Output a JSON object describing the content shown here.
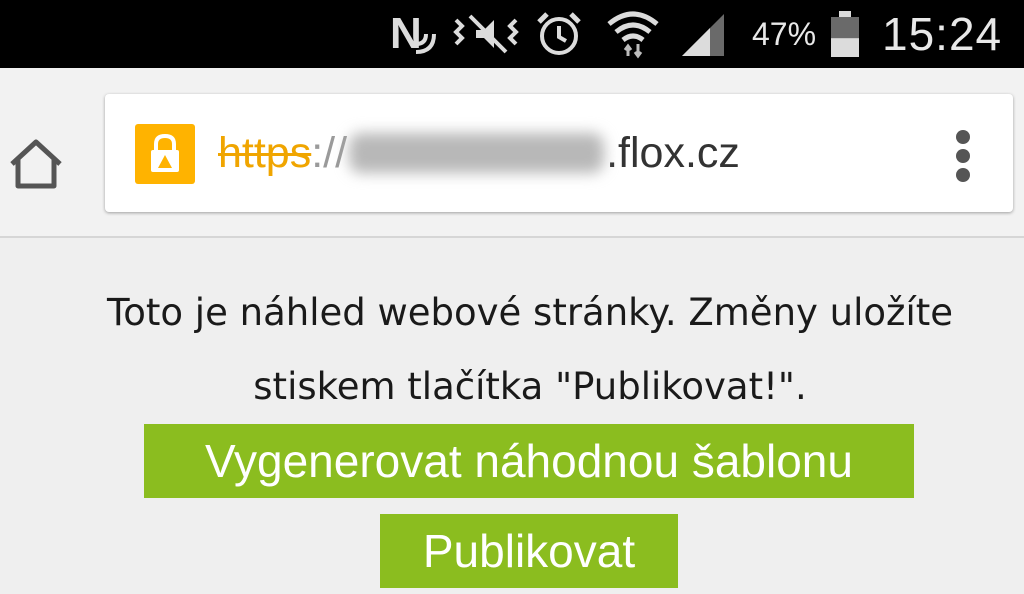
{
  "status_bar": {
    "nfc_label": "N",
    "icons": [
      "nfc-icon",
      "vibrate-icon",
      "alarm-icon",
      "wifi-icon",
      "signal-icon",
      "battery-icon"
    ],
    "battery_percent": "47%",
    "battery_level": 0.47,
    "time": "15:24"
  },
  "toolbar": {
    "url_scheme": "https",
    "url_separator": "://",
    "url_domain_suffix": ".flox.cz",
    "lock_color": "#ffb300"
  },
  "content": {
    "notice_line1": "Toto je náhled webové stránky. Změny uložíte",
    "notice_line2": "stiskem tlačítka \"Publikovat!\".",
    "generate_button": "Vygenerovat náhodnou šablonu",
    "publish_button": "Publikovat",
    "button_color": "#8bbd1f"
  }
}
